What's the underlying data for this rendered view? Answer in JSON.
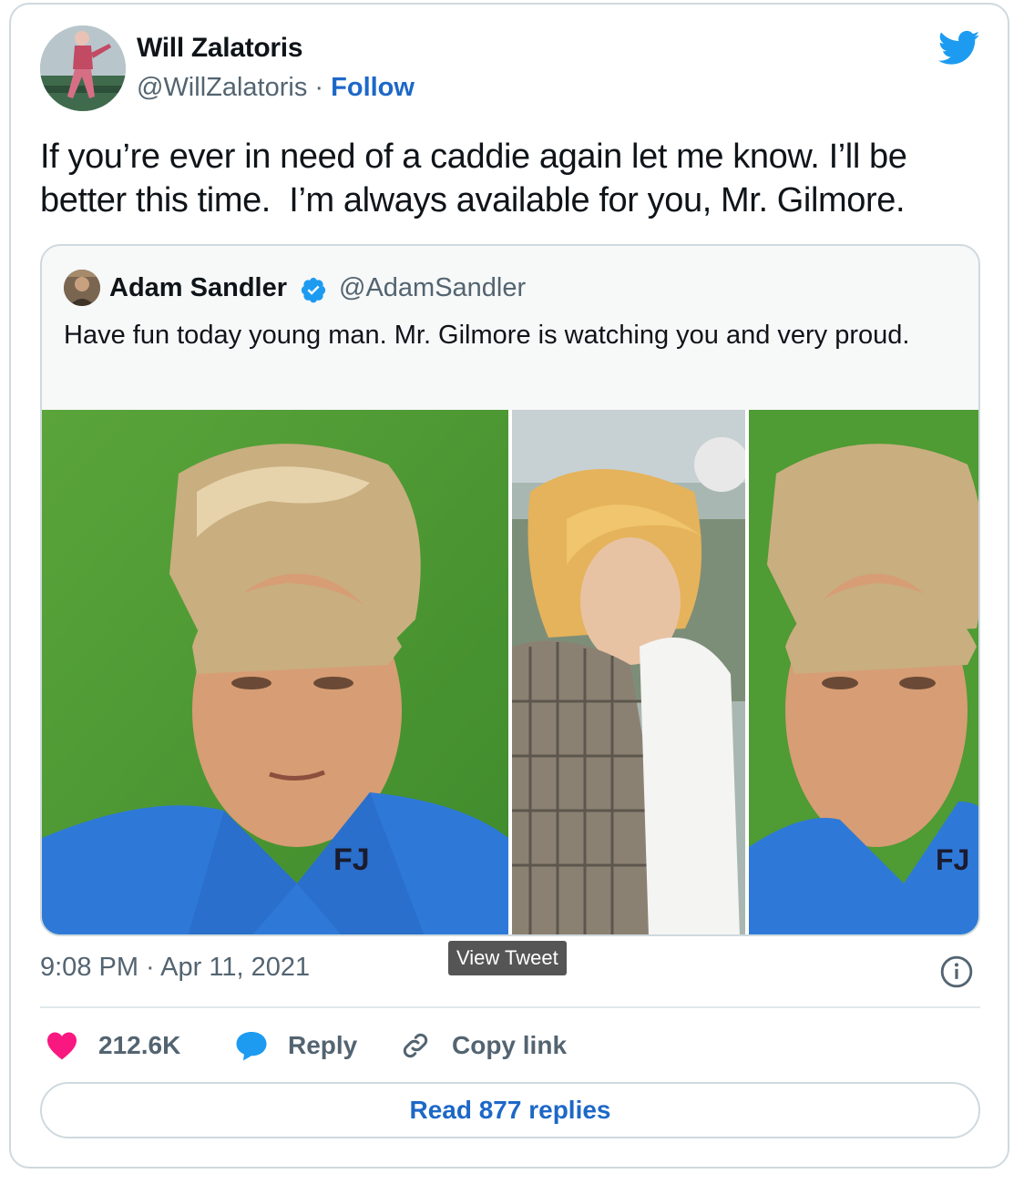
{
  "tweet": {
    "author_name": "Will Zalatoris",
    "author_handle": "@WillZalatoris",
    "separator": "·",
    "follow_label": "Follow",
    "text": "If you’re ever in need of a caddie again let me know. I’ll be better this time.  I’m always available for you, Mr. Gilmore.",
    "timestamp": "9:08 PM · Apr 11, 2021",
    "likes": "212.6K",
    "reply_label": "Reply",
    "copy_link_label": "Copy link",
    "read_replies_label": "Read 877 replies",
    "tooltip": "View Tweet"
  },
  "quoted": {
    "author_name": "Adam Sandler",
    "author_handle": "@AdamSandler",
    "text": "Have fun today young man. Mr. Gilmore is watching you and very proud.",
    "verified": true
  },
  "icons": {
    "brand": "twitter-bird-icon",
    "like": "heart-icon",
    "reply": "speech-bubble-icon",
    "copy": "link-icon",
    "info": "info-icon",
    "verified": "verified-badge-icon"
  },
  "colors": {
    "twitter_blue": "#1d9bf0",
    "link_blue": "#1d68c7",
    "heart": "#f91880",
    "muted": "#536471",
    "border": "#cfd9de"
  }
}
